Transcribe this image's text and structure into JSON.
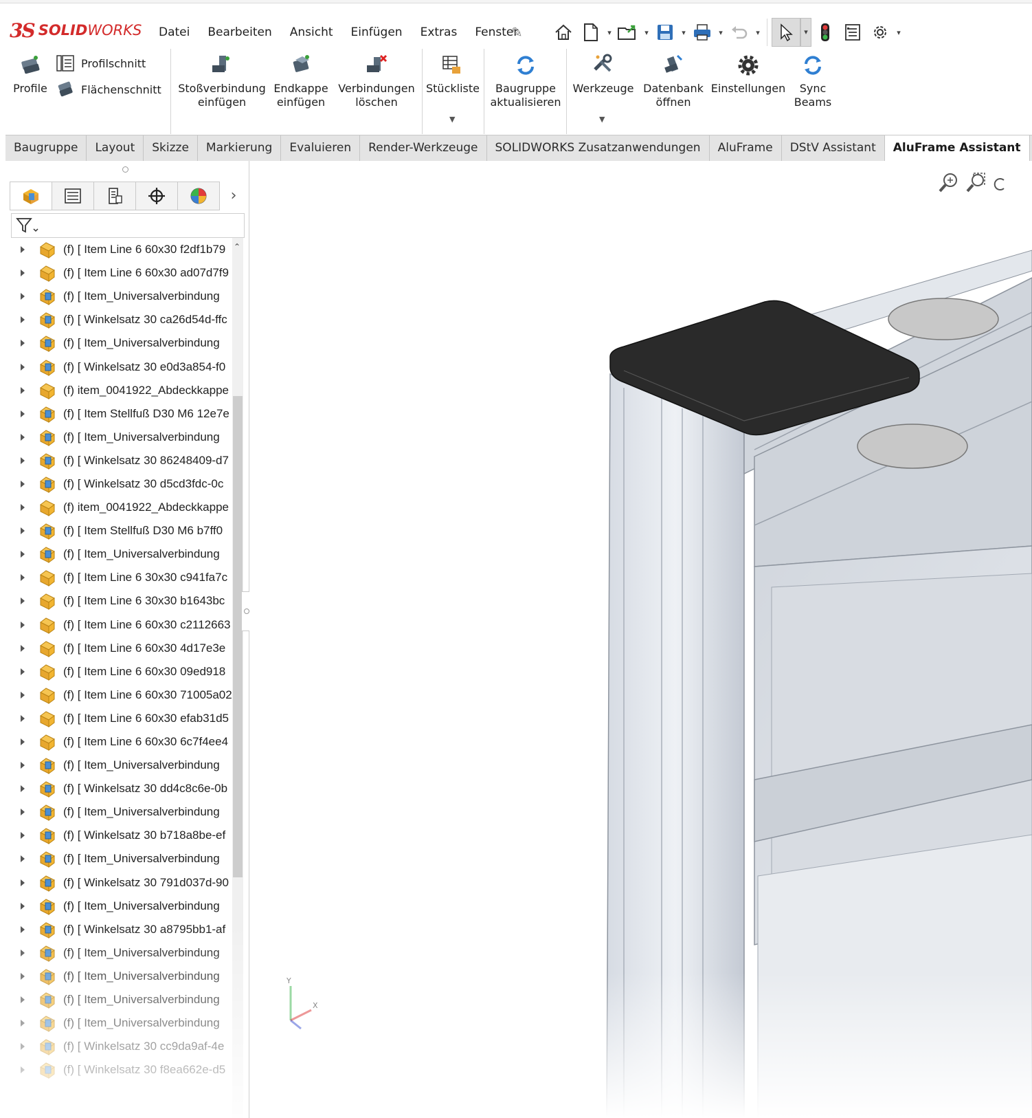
{
  "app": {
    "logo_ds": "3S",
    "brand_bold": "SOLID",
    "brand_rest": "WORKS"
  },
  "menu": [
    "Datei",
    "Bearbeiten",
    "Ansicht",
    "Einfügen",
    "Extras",
    "Fenster"
  ],
  "ribbon": {
    "profile": "Profile",
    "profilschnitt": "Profilschnitt",
    "flaechenschnitt": "Flächenschnitt",
    "stossverbindung": "Stoßverbindung\neinfügen",
    "endkappe": "Endkappe\neinfügen",
    "verbindungen": "Verbindungen\nlöschen",
    "stueckliste": "Stückliste",
    "baugruppe": "Baugruppe\naktualisieren",
    "werkzeuge": "Werkzeuge",
    "datenbank": "Datenbank\nöffnen",
    "einstellungen": "Einstellungen",
    "sync": "Sync\nBeams"
  },
  "tabs": [
    "Baugruppe",
    "Layout",
    "Skizze",
    "Markierung",
    "Evaluieren",
    "Render-Werkzeuge",
    "SOLIDWORKS Zusatzanwendungen",
    "AluFrame",
    "DStV Assistant",
    "AluFrame Assistant"
  ],
  "active_tab": "AluFrame Assistant",
  "tree": [
    {
      "text": "(f) [ Item Line 6 60x30 f2df1b79",
      "icon": "part-yellow"
    },
    {
      "text": "(f) [ Item Line 6 60x30 ad07d7f9",
      "icon": "part-yellow"
    },
    {
      "text": "(f) [ Item_Universalverbindung",
      "icon": "assembly-blue"
    },
    {
      "text": "(f) [ Winkelsatz 30 ca26d54d-ffc",
      "icon": "assembly-blue"
    },
    {
      "text": "(f) [ Item_Universalverbindung",
      "icon": "assembly-blue"
    },
    {
      "text": "(f) [ Winkelsatz 30 e0d3a854-f0",
      "icon": "assembly-blue"
    },
    {
      "text": "(f) item_0041922_Abdeckkappe",
      "icon": "part-yellow"
    },
    {
      "text": "(f) [ Item Stellfuß D30 M6 12e7e",
      "icon": "assembly-blue"
    },
    {
      "text": "(f) [ Item_Universalverbindung",
      "icon": "assembly-blue"
    },
    {
      "text": "(f) [ Winkelsatz 30 86248409-d7",
      "icon": "assembly-blue"
    },
    {
      "text": "(f) [ Winkelsatz 30 d5cd3fdc-0c",
      "icon": "assembly-blue"
    },
    {
      "text": "(f) item_0041922_Abdeckkappe",
      "icon": "part-yellow"
    },
    {
      "text": "(f) [ Item Stellfuß D30 M6 b7ff0",
      "icon": "assembly-blue"
    },
    {
      "text": "(f) [ Item_Universalverbindung",
      "icon": "assembly-blue"
    },
    {
      "text": "(f) [ Item Line 6 30x30 c941fa7c",
      "icon": "part-yellow"
    },
    {
      "text": "(f) [ Item Line 6 30x30 b1643bc",
      "icon": "part-yellow"
    },
    {
      "text": "(f) [ Item Line 6 60x30 c2112663",
      "icon": "part-yellow"
    },
    {
      "text": "(f) [ Item Line 6 60x30 4d17e3e",
      "icon": "part-yellow"
    },
    {
      "text": "(f) [ Item Line 6 60x30 09ed918",
      "icon": "part-yellow"
    },
    {
      "text": "(f) [ Item Line 6 60x30 71005a02",
      "icon": "part-yellow"
    },
    {
      "text": "(f) [ Item Line 6 60x30 efab31d5",
      "icon": "part-yellow"
    },
    {
      "text": "(f) [ Item Line 6 60x30 6c7f4ee4",
      "icon": "part-yellow"
    },
    {
      "text": "(f) [ Item_Universalverbindung",
      "icon": "assembly-blue"
    },
    {
      "text": "(f) [ Winkelsatz 30 dd4c8c6e-0b",
      "icon": "assembly-blue"
    },
    {
      "text": "(f) [ Item_Universalverbindung",
      "icon": "assembly-blue"
    },
    {
      "text": "(f) [ Winkelsatz 30 b718a8be-ef",
      "icon": "assembly-blue"
    },
    {
      "text": "(f) [ Item_Universalverbindung",
      "icon": "assembly-blue"
    },
    {
      "text": "(f) [ Winkelsatz 30 791d037d-90",
      "icon": "assembly-blue"
    },
    {
      "text": "(f) [ Item_Universalverbindung",
      "icon": "assembly-blue"
    },
    {
      "text": "(f) [ Winkelsatz 30 a8795bb1-af",
      "icon": "assembly-blue"
    },
    {
      "text": "(f) [ Item_Universalverbindung",
      "icon": "assembly-blue"
    },
    {
      "text": "(f) [ Item_Universalverbindung",
      "icon": "assembly-blue"
    },
    {
      "text": "(f) [ Item_Universalverbindung",
      "icon": "assembly-blue"
    },
    {
      "text": "(f) [ Item_Universalverbindung",
      "icon": "assembly-blue"
    },
    {
      "text": "(f) [ Winkelsatz 30 cc9da9af-4e",
      "icon": "assembly-blue"
    },
    {
      "text": "(f) [ Winkelsatz 30 f8ea662e-d5",
      "icon": "assembly-blue"
    }
  ],
  "triad": {
    "x": "X",
    "y": "Y"
  },
  "colors": {
    "brand_red": "#d32b2b",
    "part_yellow": "#f2b531",
    "assembly_blue": "#4a8fd4",
    "tab_bg": "#e4e4e4"
  }
}
